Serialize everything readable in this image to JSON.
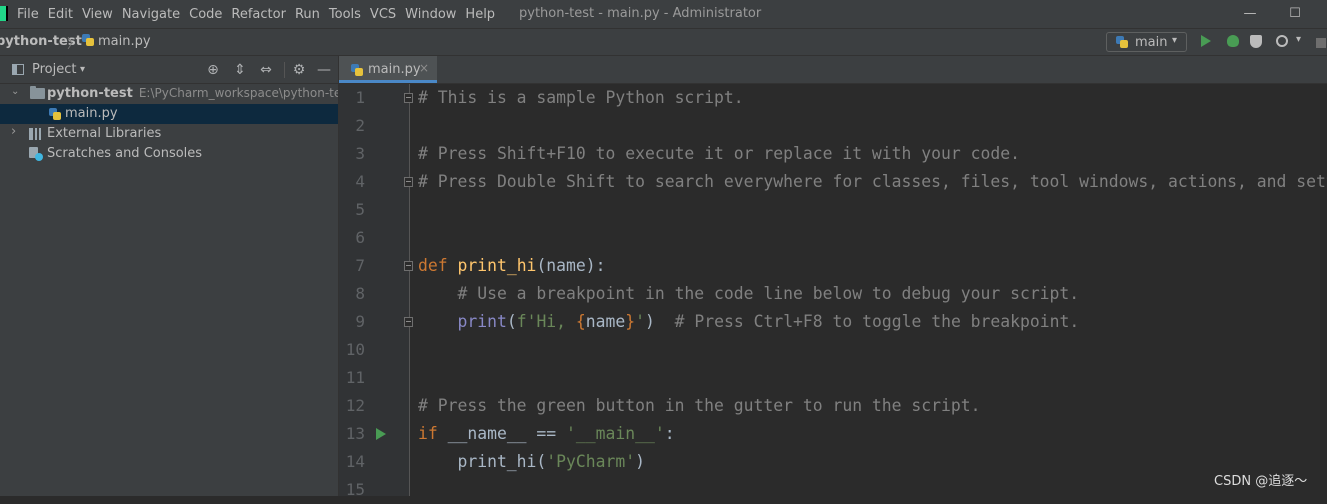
{
  "menu": [
    "File",
    "Edit",
    "View",
    "Navigate",
    "Code",
    "Refactor",
    "Run",
    "Tools",
    "VCS",
    "Window",
    "Help"
  ],
  "window_title": "python-test - main.py - Administrator",
  "window_controls": {
    "minimize": "—",
    "maximize": "☐"
  },
  "breadcrumb": {
    "project": "python-test",
    "separator": "〉",
    "file": "main.py"
  },
  "run_config": {
    "label": "main",
    "caret": "▾"
  },
  "toolbar_more": "▾",
  "project_panel": {
    "title": "Project",
    "caret": "▾",
    "buttons": {
      "locate": "⊕",
      "expand": "⇕",
      "collapse": "⇔",
      "settings": "⚙",
      "hide": "—"
    },
    "tree": [
      {
        "label": "python-test",
        "path": "E:\\PyCharm_workspace\\python-test",
        "arrow": "⌄"
      },
      {
        "label": "main.py"
      },
      {
        "label": "External Libraries",
        "arrow": "›"
      },
      {
        "label": "Scratches and Consoles"
      }
    ]
  },
  "editor": {
    "tab": {
      "label": "main.py",
      "close": "×"
    },
    "line_numbers": [
      "1",
      "2",
      "3",
      "4",
      "5",
      "6",
      "7",
      "8",
      "9",
      "10",
      "11",
      "12",
      "13",
      "14",
      "15"
    ],
    "lines": [
      [
        [
          "c-cm",
          "# This is a sample Python script."
        ]
      ],
      [],
      [
        [
          "c-cm",
          "# Press Shift+F10 to execute it or replace it with your code."
        ]
      ],
      [
        [
          "c-cm",
          "# Press Double Shift to search everywhere for classes, files, tool windows, actions, and settings."
        ]
      ],
      [],
      [],
      [
        [
          "c-kw",
          "def "
        ],
        [
          "c-fn",
          "print_hi"
        ],
        [
          "c-tx",
          "(name):"
        ]
      ],
      [
        [
          "c-cm",
          "    # Use a breakpoint in the code line below to debug your script."
        ]
      ],
      [
        [
          "c-tx",
          "    "
        ],
        [
          "c-bi",
          "print"
        ],
        [
          "c-tx",
          "("
        ],
        [
          "c-st",
          "f'Hi, "
        ],
        [
          "c-br",
          "{"
        ],
        [
          "c-tx",
          "name"
        ],
        [
          "c-br",
          "}"
        ],
        [
          "c-st",
          "'"
        ],
        [
          "c-tx",
          ")  "
        ],
        [
          "c-cm",
          "# Press Ctrl+F8 to toggle the breakpoint."
        ]
      ],
      [],
      [],
      [
        [
          "c-cm",
          "# Press the green button in the gutter to run the script."
        ]
      ],
      [
        [
          "c-kw",
          "if "
        ],
        [
          "c-tx",
          "__name__ == "
        ],
        [
          "c-st",
          "'__main__'"
        ],
        [
          "c-tx",
          ":"
        ]
      ],
      [
        [
          "c-tx",
          "    print_hi("
        ],
        [
          "c-st",
          "'PyCharm'"
        ],
        [
          "c-tx",
          ")"
        ]
      ],
      []
    ]
  },
  "watermark": "CSDN @追逐～",
  "colors": {
    "background": "#2b2b2b",
    "panel": "#3c3f41",
    "selection": "#0d293e",
    "accent": "#4a88c7",
    "run_green": "#499c54"
  }
}
